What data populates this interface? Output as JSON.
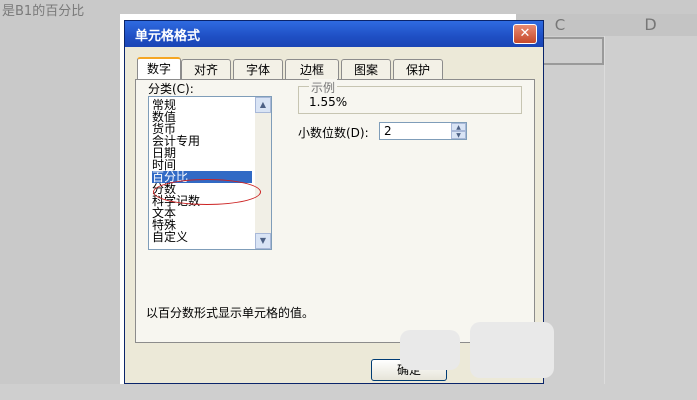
{
  "background": {
    "top_text": "是B1的百分比",
    "col_c": "C",
    "col_d": "D"
  },
  "dialog": {
    "title": "单元格格式",
    "close_label": "✕",
    "tabs": [
      {
        "label": "数字",
        "active": true
      },
      {
        "label": "对齐"
      },
      {
        "label": "字体"
      },
      {
        "label": "边框"
      },
      {
        "label": "图案"
      },
      {
        "label": "保护"
      }
    ],
    "category_label": "分类(C):",
    "categories": [
      "常规",
      "数值",
      "货币",
      "会计专用",
      "日期",
      "时间",
      "百分比",
      "分数",
      "科学记数",
      "文本",
      "特殊",
      "自定义"
    ],
    "selected_category": "百分比",
    "sample_label": "示例",
    "sample_value": "1.55%",
    "decimal_label": "小数位数(D):",
    "decimal_value": "2",
    "description": "以百分数形式显示单元格的值。",
    "ok_label": "确定"
  },
  "colors": {
    "title_bar": "#1f4fc4",
    "selection": "#316ac5",
    "annotation_circle": "#cc2222"
  }
}
